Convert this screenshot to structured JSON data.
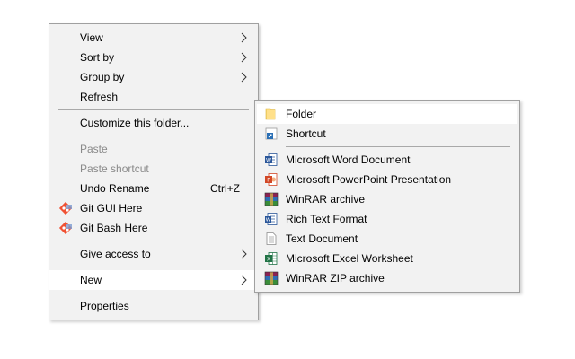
{
  "context_menu": {
    "items": [
      {
        "label": "View"
      },
      {
        "label": "Sort by"
      },
      {
        "label": "Group by"
      },
      {
        "label": "Refresh"
      },
      {
        "label": "Customize this folder..."
      },
      {
        "label": "Paste"
      },
      {
        "label": "Paste shortcut"
      },
      {
        "label": "Undo Rename",
        "shortcut": "Ctrl+Z"
      },
      {
        "label": "Git GUI Here",
        "icon": "git-icon"
      },
      {
        "label": "Git Bash Here",
        "icon": "git-icon"
      },
      {
        "label": "Give access to"
      },
      {
        "label": "New"
      },
      {
        "label": "Properties"
      }
    ]
  },
  "new_submenu": {
    "items": [
      {
        "label": "Folder",
        "icon": "folder-icon"
      },
      {
        "label": "Shortcut",
        "icon": "shortcut-icon"
      },
      {
        "label": "Microsoft Word Document",
        "icon": "word-icon"
      },
      {
        "label": "Microsoft PowerPoint Presentation",
        "icon": "powerpoint-icon"
      },
      {
        "label": "WinRAR archive",
        "icon": "winrar-icon"
      },
      {
        "label": "Rich Text Format",
        "icon": "rtf-icon"
      },
      {
        "label": "Text Document",
        "icon": "text-document-icon"
      },
      {
        "label": "Microsoft Excel Worksheet",
        "icon": "excel-icon"
      },
      {
        "label": "WinRAR ZIP archive",
        "icon": "winrar-zip-icon"
      }
    ]
  },
  "colors": {
    "menu_bg": "#f2f2f2",
    "highlight": "#ffffff",
    "disabled_text": "#8a8a8a",
    "border": "#a0a0a0"
  }
}
